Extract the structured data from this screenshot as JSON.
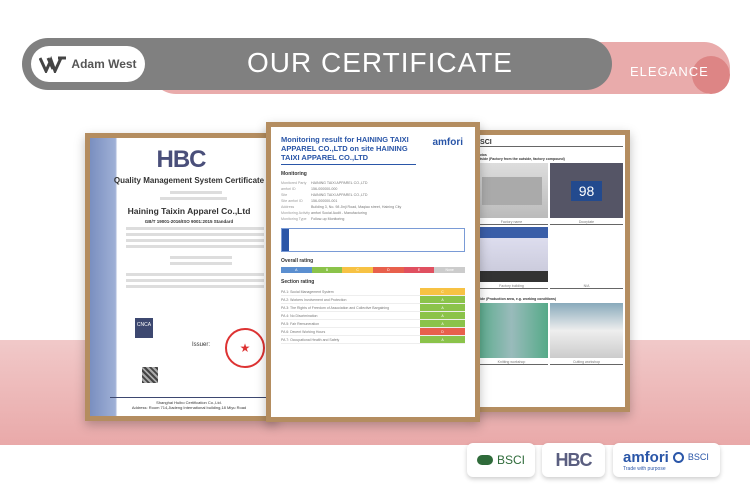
{
  "header": {
    "brand": "Adam West",
    "title": "OUR CERTIFICATE",
    "tagline": "ELEGANCE"
  },
  "cert_hbc": {
    "logo": "HBC",
    "title": "Quality Management System Certificate",
    "company": "Haining Taixin Apparel Co.,Ltd",
    "standard": "GB/T 19001-2016/ISO 9001:2015 Standard",
    "issuer_label": "Issuer:",
    "cnca": "CNCA",
    "footer": "Shanghai Huibo Certification Co.,Ltd.",
    "address": "Address: Room 714,Jiadeng International building,18 Miyu Road"
  },
  "cert_amfori": {
    "title": "Monitoring result for HAINING TAIXI APPAREL CO.,LTD on site HAINING TAIXI APPAREL CO.,LTD",
    "logo": "amfori",
    "section": "Monitoring",
    "rows": [
      [
        "Monitored Party",
        "HAINING TAIXI APPAREL CO.,LTD"
      ],
      [
        "amfori ID",
        "156-000000-000"
      ],
      [
        "Site",
        "HAINING TAIXI APPAREL CO.,LTD"
      ],
      [
        "Site amfori ID",
        "156-000000-001"
      ],
      [
        "Address",
        "Building 3, No. 98 Jinji Road, Maqiao street, Haining City"
      ],
      [
        "Monitoring Activity",
        "amfori Social Audit - Manufacturing"
      ],
      [
        "Monitoring Type",
        "Follow-up Monitoring"
      ]
    ],
    "overall_label": "Overall rating",
    "overall": [
      "A",
      "B",
      "C",
      "D",
      "E",
      "None"
    ],
    "section_label": "Section rating",
    "sections": [
      [
        "PA 1: Social Management System",
        "C"
      ],
      [
        "PA 2: Workers Involvement and Protection",
        "A"
      ],
      [
        "PA 3: The Rights of Freedom of Association and Collective Bargaining",
        "A"
      ],
      [
        "PA 4: No Discrimination",
        "A"
      ],
      [
        "PA 5: Fair Remuneration",
        "A"
      ],
      [
        "PA 6: Decent Working Hours",
        "D"
      ],
      [
        "PA 7: Occupational Health and Safety",
        "A"
      ]
    ]
  },
  "cert_bsci": {
    "logo": "BSCI",
    "photos_label": "Photos",
    "outside_label": "Outside (Factory from the outside, factory compound)",
    "captions": [
      "Factory name",
      "Doorplate",
      "Factory building",
      "N/A"
    ],
    "inside_label": "Inside (Production area, e.g. working conditions)",
    "captions2": [
      "Knitting workshop",
      "Cutting workshop"
    ],
    "doorplate": "98"
  },
  "badges": {
    "bsci": "BSCI",
    "hbc": "HBC",
    "amfori": "amfori",
    "amfori_sub": "Trade with purpose",
    "amfori_bsci": "BSCI"
  }
}
